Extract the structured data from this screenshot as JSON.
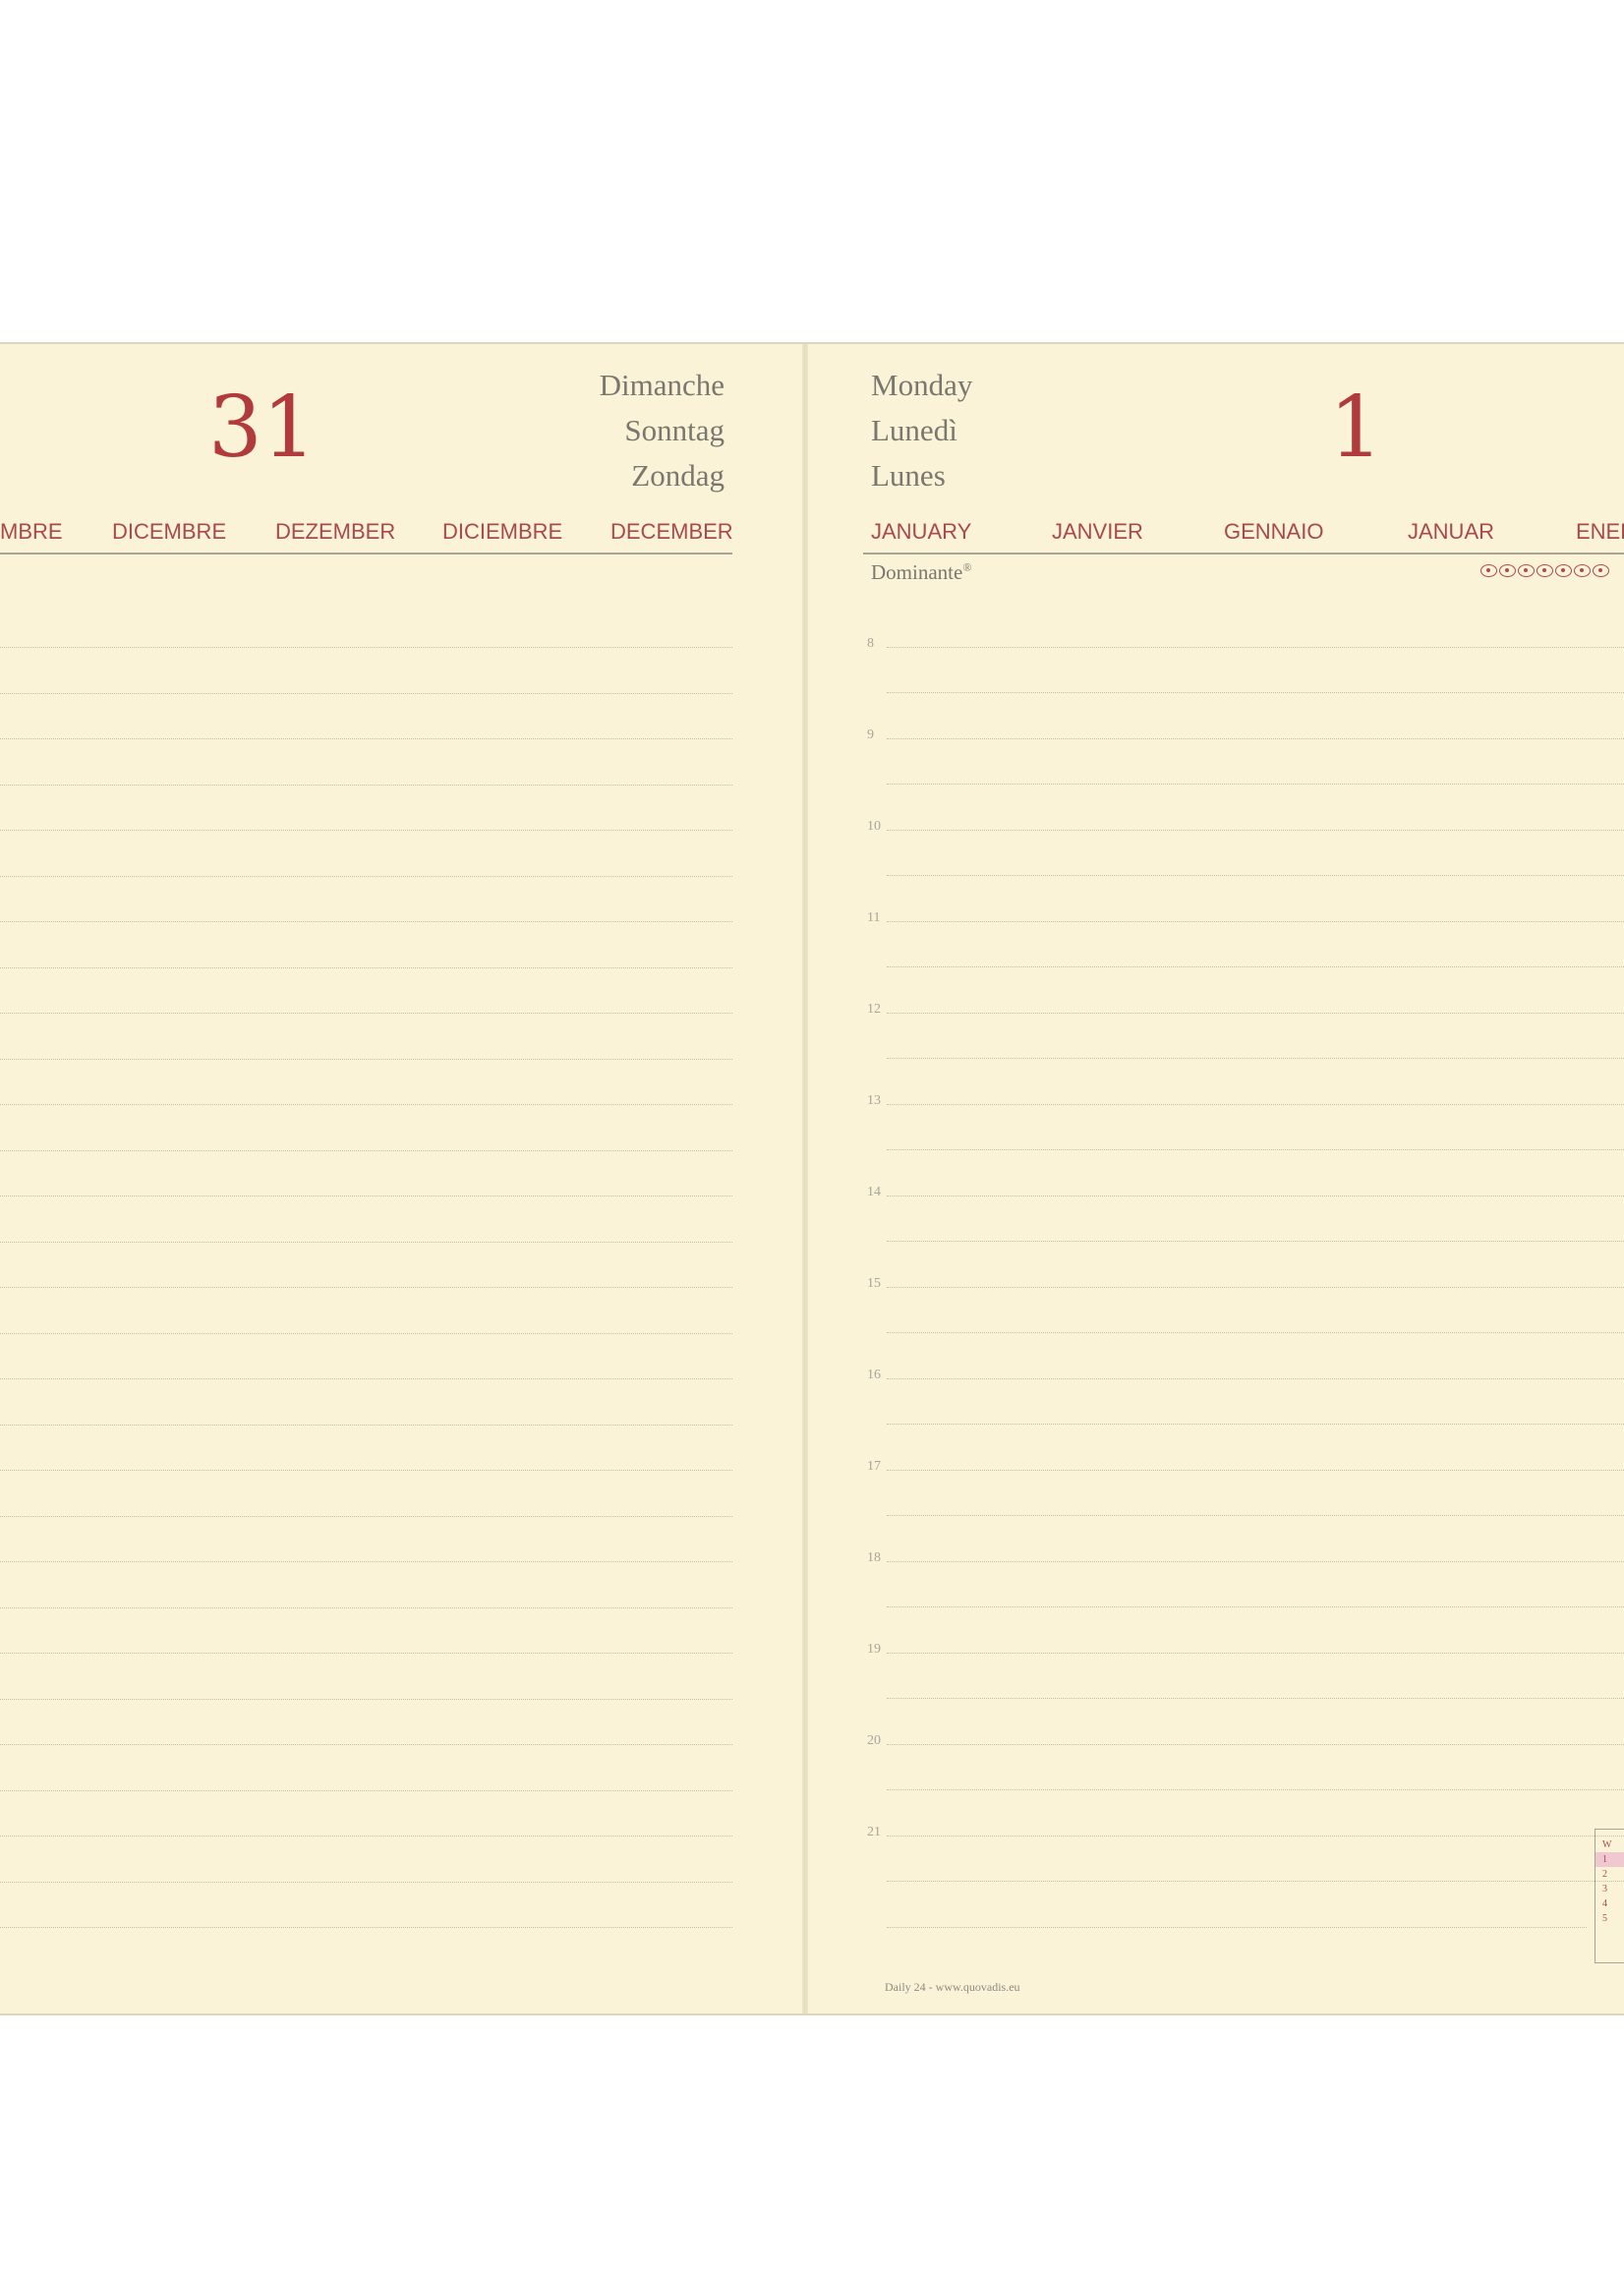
{
  "left_page": {
    "day_number": "31",
    "day_names": [
      "Dimanche",
      "Sonntag",
      "Zondag"
    ],
    "months": [
      "MBRE",
      "DICEMBRE",
      "DEZEMBER",
      "DICIEMBRE",
      "DECEMBER"
    ]
  },
  "right_page": {
    "day_names": [
      "Monday",
      "Lunedì",
      "Lunes"
    ],
    "day_number": "1",
    "months": [
      "JANUARY",
      "JANVIER",
      "GENNAIO",
      "JANUAR",
      "ENEF"
    ],
    "dominante_label": "Dominante",
    "dominante_mark": "®",
    "moon_icons": 7,
    "hours": [
      "8",
      "9",
      "10",
      "11",
      "12",
      "13",
      "14",
      "15",
      "16",
      "17",
      "18",
      "19",
      "20",
      "21"
    ],
    "footer": "Daily 24 - www.quovadis.eu",
    "week_box": {
      "header": "W",
      "weeks": [
        "1",
        "2",
        "3",
        "4",
        "5"
      ],
      "current_week": "1"
    }
  },
  "colors": {
    "paper": "#faf3d8",
    "accent_red": "#b03a3c",
    "text_grey": "#7a776e"
  }
}
